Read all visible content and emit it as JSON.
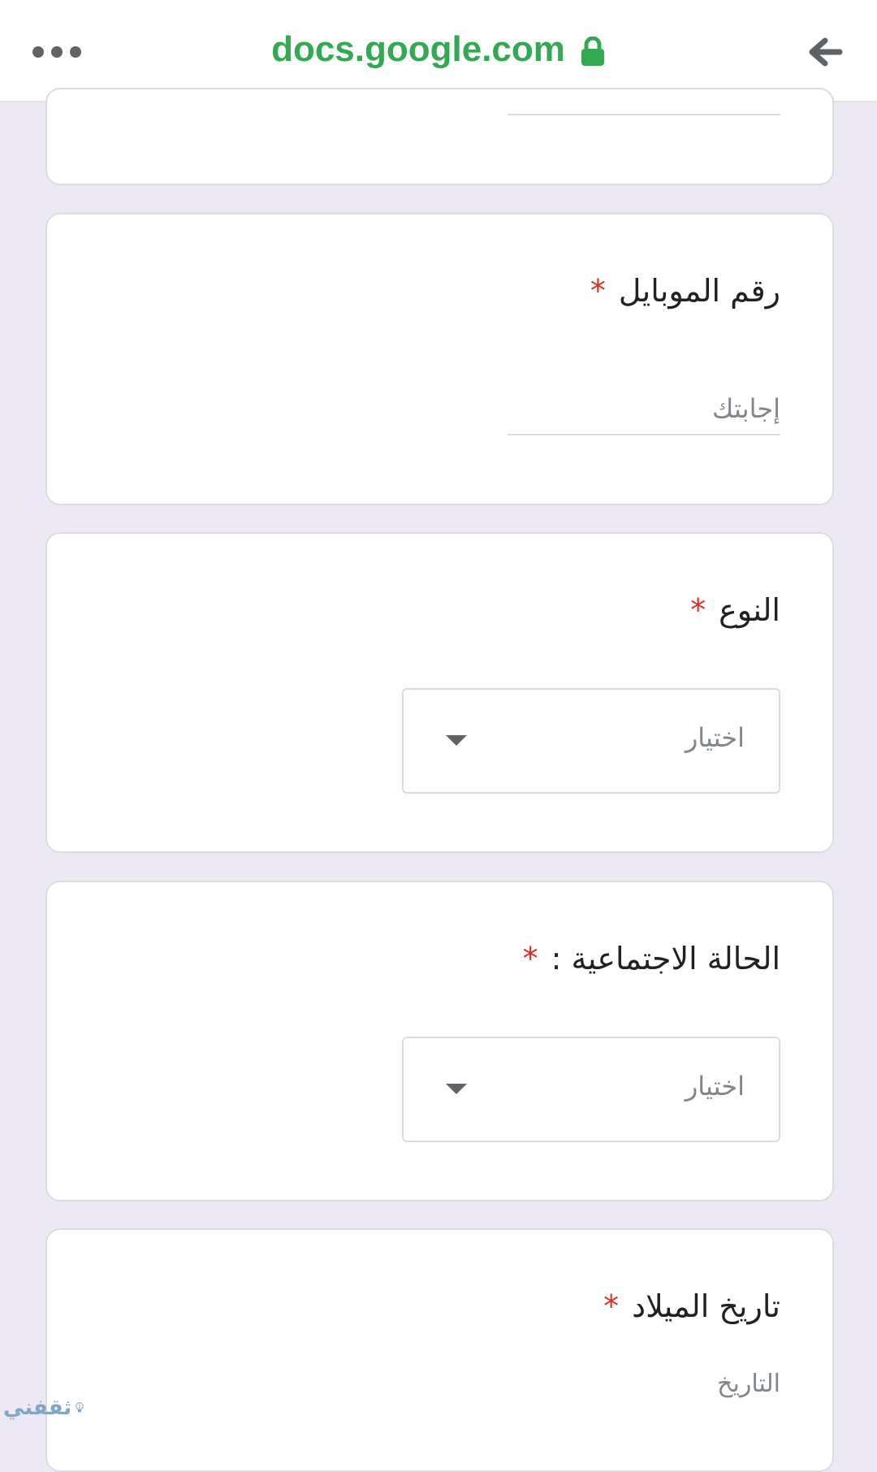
{
  "browser": {
    "url": "docs.google.com",
    "menu_icon": "more-horizontal-icon",
    "lock_icon": "lock-icon",
    "back_icon": "arrow-back-icon",
    "url_color": "#34a853"
  },
  "form": {
    "background_color": "#ede8f6",
    "required_marker": "*",
    "required_color": "#d93025",
    "questions": [
      {
        "title": "رقم الموبايل",
        "type": "short-answer",
        "placeholder": "إجابتك"
      },
      {
        "title": "النوع",
        "type": "dropdown",
        "selected": "اختيار"
      },
      {
        "title": "الحالة الاجتماعية :",
        "type": "dropdown",
        "selected": "اختيار"
      },
      {
        "title": "تاريخ الميلاد",
        "type": "date",
        "placeholder": "التاريخ"
      }
    ]
  },
  "watermark": {
    "text": "ثقفني"
  }
}
